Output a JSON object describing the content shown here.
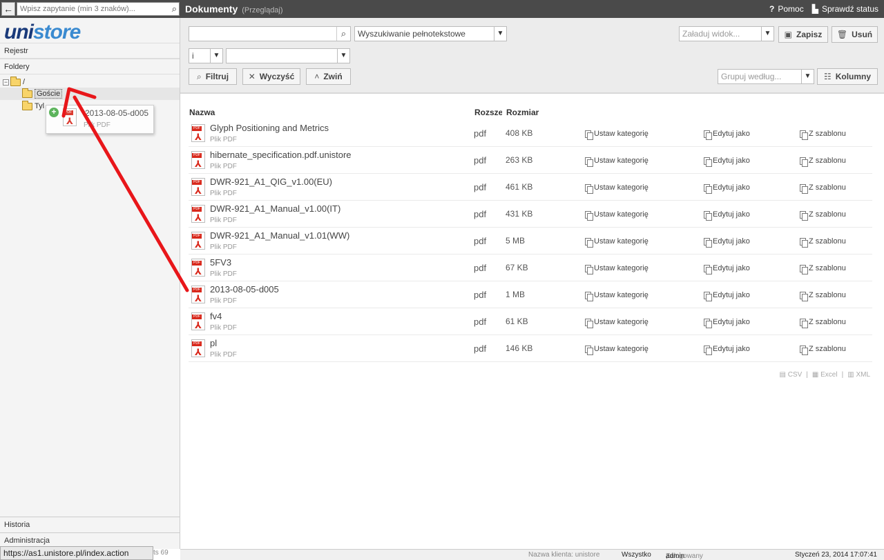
{
  "topbar": {
    "search_placeholder": "Wpisz zapytanie (min 3 znaków)...",
    "title": "Dokumenty",
    "subtitle": "(Przeglądaj)",
    "help": "Pomoc",
    "status": "Sprawdź status"
  },
  "sidebar": {
    "logo_a": "uni",
    "logo_b": "store",
    "registry": "Rejestr",
    "folders": "Foldery",
    "tree": {
      "root": "/",
      "child1": "Goście",
      "child2": "Tyl"
    },
    "history": "Historia",
    "admin": "Administracja",
    "stats": "ts 69"
  },
  "drag_popup": {
    "name": "2013-08-05-d005",
    "type": "Plik PDF"
  },
  "toolbar": {
    "search_value": "",
    "search_mode": "Wyszukiwanie pełnotekstowe",
    "operator": "i",
    "field_value": "",
    "view_placeholder": "Załaduj widok...",
    "save": "Zapisz",
    "delete": "Usuń",
    "filter": "Filtruj",
    "clear": "Wyczyść",
    "collapse": "Zwiń",
    "group_placeholder": "Grupuj według...",
    "columns": "Kolumny"
  },
  "table": {
    "headers": {
      "name": "Nazwa",
      "ext": "Rozsze",
      "size": "Rozmiar"
    },
    "actions": {
      "category": "Ustaw kategorię",
      "edit_as": "Edytuj jako",
      "from_template": "Z szablonu"
    },
    "rows": [
      {
        "name": "Glyph Positioning and Metrics",
        "type": "Plik PDF",
        "ext": "pdf",
        "size": "408 KB"
      },
      {
        "name": "hibernate_specification.pdf.unistore",
        "type": "Plik PDF",
        "ext": "pdf",
        "size": "263 KB"
      },
      {
        "name": "DWR-921_A1_QIG_v1.00(EU)",
        "type": "Plik PDF",
        "ext": "pdf",
        "size": "461 KB"
      },
      {
        "name": "DWR-921_A1_Manual_v1.00(IT)",
        "type": "Plik PDF",
        "ext": "pdf",
        "size": "431 KB"
      },
      {
        "name": "DWR-921_A1_Manual_v1.01(WW)",
        "type": "Plik PDF",
        "ext": "pdf",
        "size": "5 MB"
      },
      {
        "name": "5FV3",
        "type": "Plik PDF",
        "ext": "pdf",
        "size": "67 KB"
      },
      {
        "name": "2013-08-05-d005",
        "type": "Plik PDF",
        "ext": "pdf",
        "size": "1 MB"
      },
      {
        "name": "fv4",
        "type": "Plik PDF",
        "ext": "pdf",
        "size": "61 KB"
      },
      {
        "name": "pl",
        "type": "Plik PDF",
        "ext": "pdf",
        "size": "146 KB"
      }
    ]
  },
  "export": {
    "csv": "CSV",
    "excel": "Excel",
    "xml": "XML"
  },
  "footer": {
    "client_label": "Nazwa klienta: unistore",
    "all": "Wszystko",
    "logged_prefix": "Zalogowany jako",
    "user": "admin",
    "logout": ", wyloguj się.",
    "date": "Styczeń 23, 2014 17:07:41"
  },
  "statusbar": {
    "url": "https://as1.unistore.pl/index.action"
  },
  "colors": {
    "arrow": "#e8161a",
    "topbar": "#4a4a4a",
    "pdf": "#d9291c"
  }
}
